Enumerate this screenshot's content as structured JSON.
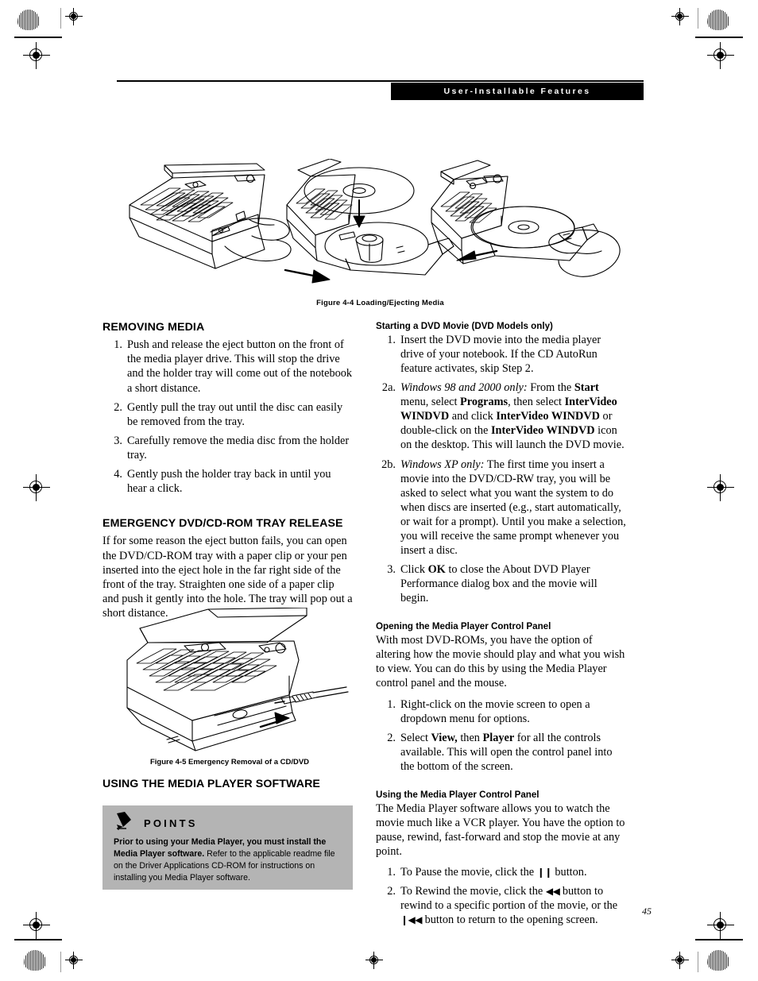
{
  "header": {
    "banner_title": "User-Installable Features"
  },
  "figures": {
    "loading_ejecting": {
      "caption": "Figure 4-4  Loading/Ejecting Media",
      "panels": [
        {
          "name": "press-eject-button"
        },
        {
          "name": "insert-disc-on-tray"
        },
        {
          "name": "close-tray-with-disc"
        }
      ]
    },
    "emergency_removal": {
      "caption": "Figure 4-5 Emergency Removal of a CD/DVD"
    }
  },
  "left_column": {
    "removing_media": {
      "heading": "REMOVING MEDIA",
      "steps": [
        {
          "num": "1.",
          "text": "Push and release the eject button on the front of the media player drive. This will stop the drive and the holder tray will come out of the notebook a short distance."
        },
        {
          "num": "2.",
          "text": "Gently pull the tray out until the disc can easily be removed from the tray."
        },
        {
          "num": "3.",
          "text": "Carefully remove the media disc from the holder tray."
        },
        {
          "num": "4.",
          "text": "Gently push the holder tray back in until you hear a click."
        }
      ]
    },
    "emergency_release": {
      "heading": "EMERGENCY DVD/CD-ROM TRAY RELEASE",
      "body": "If for some reason the eject button fails, you can open the DVD/CD-ROM tray with a paper clip or your pen inserted into the eject hole in the far right side of the front of the tray. Straighten one side of a paper clip and push it gently into the hole. The tray will pop out a short distance."
    },
    "using_media_player": {
      "heading": "USING THE MEDIA PLAYER SOFTWARE"
    },
    "points_box": {
      "title": "POINTS",
      "icon": "pencil-icon",
      "lead": "Prior to using your Media Player, you must install the Media Player software.",
      "rest": " Refer to the applicable readme file on the Driver Applications CD-ROM for instructions on installing you Media Player software.",
      "background_color": "#b4b4b4"
    }
  },
  "right_column": {
    "starting_dvd_movie": {
      "heading": "Starting a DVD Movie (DVD Models only)",
      "steps": [
        {
          "num": "1.",
          "parts": [
            {
              "style": "normal",
              "text": "Insert the DVD movie into the media player drive of your notebook. If the CD AutoRun feature activates, skip Step 2."
            }
          ]
        },
        {
          "num": "2a.",
          "parts": [
            {
              "style": "italic",
              "text": "Windows 98 and 2000 only:"
            },
            {
              "style": "normal",
              "text": " From the "
            },
            {
              "style": "bold",
              "text": "Start"
            },
            {
              "style": "normal",
              "text": " menu, select "
            },
            {
              "style": "bold",
              "text": "Programs"
            },
            {
              "style": "normal",
              "text": ", then select "
            },
            {
              "style": "bold",
              "text": "InterVideo WINDVD"
            },
            {
              "style": "normal",
              "text": " and click "
            },
            {
              "style": "bold",
              "text": "InterVideo WINDVD"
            },
            {
              "style": "normal",
              "text": " or double-click on the "
            },
            {
              "style": "bold",
              "text": "InterVideo WINDVD"
            },
            {
              "style": "normal",
              "text": " icon on the desktop. This will launch the DVD movie."
            }
          ]
        },
        {
          "num": "2b.",
          "parts": [
            {
              "style": "italic",
              "text": "Windows XP only:"
            },
            {
              "style": "normal",
              "text": " The first time you insert a movie into the DVD/CD-RW tray, you will be asked to select what you want the system to do when discs are inserted (e.g., start automatically, or wait for a prompt). Until you make a selection, you will receive the same prompt whenever you insert a disc."
            }
          ]
        },
        {
          "num": "3.",
          "parts": [
            {
              "style": "normal",
              "text": "Click "
            },
            {
              "style": "bold",
              "text": "OK"
            },
            {
              "style": "normal",
              "text": " to close the About DVD Player Performance dialog box and the movie will begin."
            }
          ]
        }
      ]
    },
    "opening_control_panel": {
      "heading": "Opening the Media Player Control Panel",
      "body": "With most DVD-ROMs, you have the option of altering how the movie should play and what you wish to view. You can do this by using the Media Player control panel and the mouse.",
      "steps": [
        {
          "num": "1.",
          "parts": [
            {
              "style": "normal",
              "text": "Right-click on the movie screen to open a dropdown menu for options."
            }
          ]
        },
        {
          "num": "2.",
          "parts": [
            {
              "style": "normal",
              "text": "Select "
            },
            {
              "style": "bold",
              "text": "View,"
            },
            {
              "style": "normal",
              "text": " then "
            },
            {
              "style": "bold",
              "text": "Player"
            },
            {
              "style": "normal",
              "text": " for all the controls available. This will open the control panel into the bottom of the screen."
            }
          ]
        }
      ]
    },
    "using_control_panel": {
      "heading": "Using the Media Player Control Panel",
      "body": "The Media Player software allows you to watch the movie much like a VCR player. You have the option to pause, rewind, fast-forward and stop the movie at any point.",
      "steps": [
        {
          "num": "1.",
          "parts": [
            {
              "style": "normal",
              "text": "To Pause the movie, click the "
            },
            {
              "style": "glyph",
              "text": "❙❙"
            },
            {
              "style": "normal",
              "text": " button."
            }
          ]
        },
        {
          "num": "2.",
          "parts": [
            {
              "style": "normal",
              "text": "To Rewind the movie, click the "
            },
            {
              "style": "glyph",
              "text": "◀◀"
            },
            {
              "style": "normal",
              "text": " button to rewind to a specific portion of the movie, or the "
            },
            {
              "style": "glyph",
              "text": "❙◀◀"
            },
            {
              "style": "normal",
              "text": " button to return to the opening screen."
            }
          ]
        }
      ]
    }
  },
  "footer": {
    "page_number": "45"
  }
}
